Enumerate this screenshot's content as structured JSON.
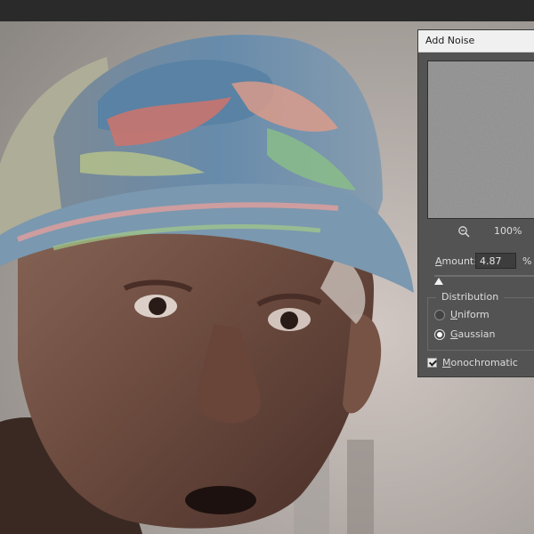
{
  "dialog": {
    "title": "Add Noise",
    "zoom": "100%",
    "amount": {
      "label_first": "A",
      "label_rest": "mount:",
      "value": "4.87",
      "unit": "%",
      "slider_fraction": 0.01
    },
    "distribution": {
      "legend": "Distribution",
      "options": [
        {
          "label_first": "U",
          "label_rest": "niform",
          "selected": false
        },
        {
          "label_first": "G",
          "label_rest": "aussian",
          "selected": true
        }
      ]
    },
    "monochromatic": {
      "label_first": "M",
      "label_rest": "onochromatic",
      "checked": true
    }
  },
  "icons": [
    "zoom-out-icon"
  ],
  "colors": {
    "dialog_bg": "#535353",
    "title_bar": "#f0f0f0",
    "text": "#dcdcdc",
    "app_chrome": "#2a2a2a"
  }
}
